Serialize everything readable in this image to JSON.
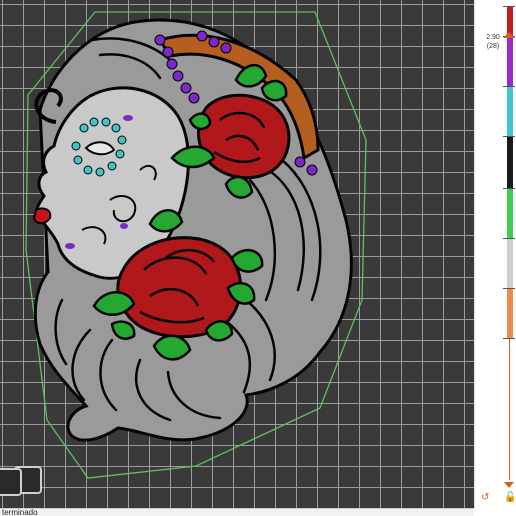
{
  "viewport": {
    "grid_color": "#9c9c9c",
    "background_color": "#3a3a3a",
    "outline_color": "#5fbf5f",
    "model_colors": {
      "hair": "#9a9a9a",
      "face": "#c9c9c9",
      "rose": "#b0181b",
      "leaf": "#24a832",
      "band": "#b45f1f",
      "beads": "#7a29c9",
      "eye_accent": "#3fc4c8",
      "lips": "#c8131b",
      "ink": "#050505"
    }
  },
  "view_toggle": {
    "icon": "cube-view-icon"
  },
  "status_bar": {
    "text": "terminado"
  },
  "layer_slider": {
    "current_height": "2.90",
    "current_layer": "(28)",
    "segments": [
      {
        "color": "#c21d1d"
      },
      {
        "color": "#9b2bd1"
      },
      {
        "color": "#3fc7d1"
      },
      {
        "color": "#1a1a1a"
      },
      {
        "color": "#3bd14a"
      },
      {
        "color": "#cfcfcf"
      },
      {
        "color": "#f08a4b"
      }
    ],
    "handle_color": "#e05a1a",
    "undo_icon": "undo-icon",
    "lock_icon": "unlock-icon"
  }
}
